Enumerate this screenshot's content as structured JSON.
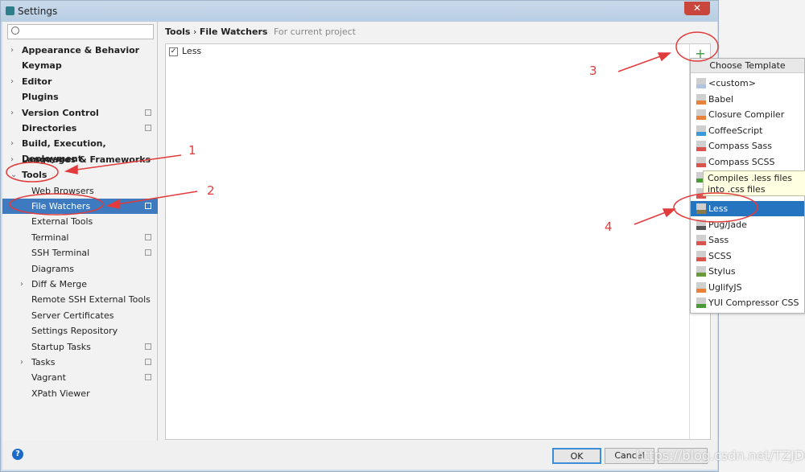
{
  "window": {
    "title": "Settings",
    "close": "✕"
  },
  "sidebar": {
    "search_placeholder": "",
    "items": [
      {
        "label": "Appearance & Behavior"
      },
      {
        "label": "Keymap"
      },
      {
        "label": "Editor"
      },
      {
        "label": "Plugins"
      },
      {
        "label": "Version Control"
      },
      {
        "label": "Directories"
      },
      {
        "label": "Build, Execution, Deployment"
      },
      {
        "label": "Languages & Frameworks"
      },
      {
        "label": "Tools"
      },
      {
        "label": "Web Browsers"
      },
      {
        "label": "File Watchers"
      },
      {
        "label": "External Tools"
      },
      {
        "label": "Terminal"
      },
      {
        "label": "SSH Terminal"
      },
      {
        "label": "Diagrams"
      },
      {
        "label": "Diff & Merge"
      },
      {
        "label": "Remote SSH External Tools"
      },
      {
        "label": "Server Certificates"
      },
      {
        "label": "Settings Repository"
      },
      {
        "label": "Startup Tasks"
      },
      {
        "label": "Tasks"
      },
      {
        "label": "Vagrant"
      },
      {
        "label": "XPath Viewer"
      }
    ]
  },
  "content": {
    "crumb_parent": "Tools",
    "crumb_sep": "›",
    "crumb_current": "File Watchers",
    "scope": "For current project",
    "watchers": [
      {
        "label": "Less",
        "checked": true
      }
    ],
    "add": "+"
  },
  "popup": {
    "title": "Choose Template",
    "items": [
      {
        "label": "<custom>",
        "badge": "#b0c4de"
      },
      {
        "label": "Babel",
        "badge": "#e8823a"
      },
      {
        "label": "Closure Compiler",
        "badge": "#e8823a"
      },
      {
        "label": "CoffeeScript",
        "badge": "#3a9ad9"
      },
      {
        "label": "Compass Sass",
        "badge": "#d9534f"
      },
      {
        "label": "Compass SCSS",
        "badge": "#d9534f"
      },
      {
        "label": "CSS",
        "badge": "#4a9a3a"
      },
      {
        "label": "HAML",
        "badge": "#d9534f"
      },
      {
        "label": "Less",
        "badge": "#8a7a4a",
        "selected": true
      },
      {
        "label": "Pug/Jade",
        "badge": "#555555"
      },
      {
        "label": "Sass",
        "badge": "#d9534f"
      },
      {
        "label": "SCSS",
        "badge": "#d9534f"
      },
      {
        "label": "Stylus",
        "badge": "#6a9a3a"
      },
      {
        "label": "UglifyJS",
        "badge": "#e8823a"
      },
      {
        "label": "YUI Compressor CSS",
        "badge": "#4a9a3a"
      }
    ]
  },
  "tooltip": "Compiles .less files into .css files",
  "footer": {
    "help": "?",
    "ok": "OK",
    "cancel": "Cancel",
    "apply": ""
  },
  "annotations": [
    "1",
    "2",
    "3",
    "4"
  ],
  "watermark": "https://blog.csdn.net/TZJD89",
  "colors": {
    "selection": "#3d7ac0",
    "annotation": "#e23b3b"
  }
}
